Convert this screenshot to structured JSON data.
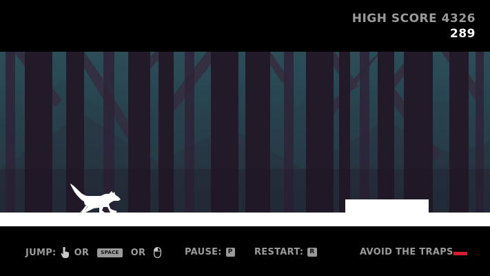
{
  "hud": {
    "high_score_label": "HIGH SCORE 4326",
    "score": "289"
  },
  "controls": {
    "jump_label": "JUMP:",
    "or_1": "OR",
    "space_key": "SPACE",
    "or_2": "OR",
    "pause_label": "PAUSE:",
    "pause_key": "P",
    "restart_label": "RESTART:",
    "restart_key": "R",
    "avoid_label": "AVOID THE TRAPS"
  },
  "icons": {
    "jump_tap": "hand-pointer-icon",
    "jump_mouse": "mouse-icon",
    "player": "wolf-icon"
  },
  "colors": {
    "background": "#000000",
    "ground": "#ffffff",
    "forest_sky": "#2a4a55",
    "tree_trunk": "#231a2a",
    "muted_text": "#9a9a9a",
    "trap_accent": "#d71f2b"
  }
}
